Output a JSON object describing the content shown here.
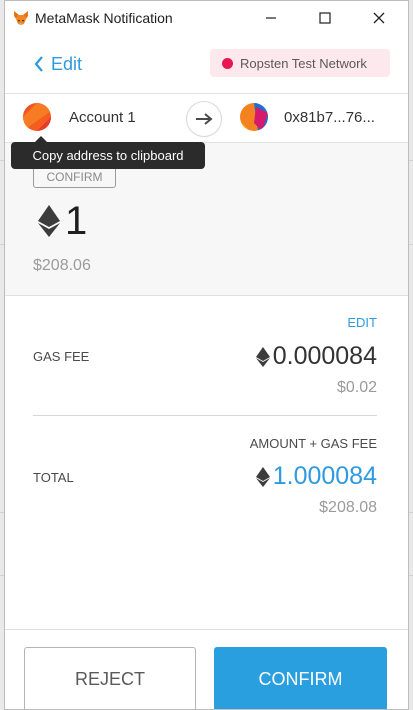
{
  "window": {
    "title": "MetaMask Notification",
    "icon": "metamask-fox-icon",
    "controls": [
      "minimize-icon",
      "maximize-icon",
      "close-icon"
    ]
  },
  "header": {
    "back_label": "Edit",
    "network_label": "Ropsten Test Network",
    "network_color": "#e91550"
  },
  "accounts": {
    "from_name": "Account 1",
    "to_address": "0x81b7...76..."
  },
  "tooltip": {
    "text": "Copy address to clipboard"
  },
  "summary": {
    "badge": "CONFIRM",
    "amount": "1",
    "fiat": "$208.06"
  },
  "details": {
    "edit_label": "EDIT",
    "gas_fee_label": "GAS FEE",
    "gas_fee_eth": "0.000084",
    "gas_fee_fiat": "$0.02",
    "total_header": "AMOUNT + GAS FEE",
    "total_label": "TOTAL",
    "total_eth": "1.000084",
    "total_fiat": "$208.08"
  },
  "footer": {
    "reject_label": "REJECT",
    "confirm_label": "CONFIRM"
  },
  "colors": {
    "accent": "#2f9ae0",
    "confirm_button": "#2a9fdf",
    "network_pill_bg": "#fde8ee"
  }
}
